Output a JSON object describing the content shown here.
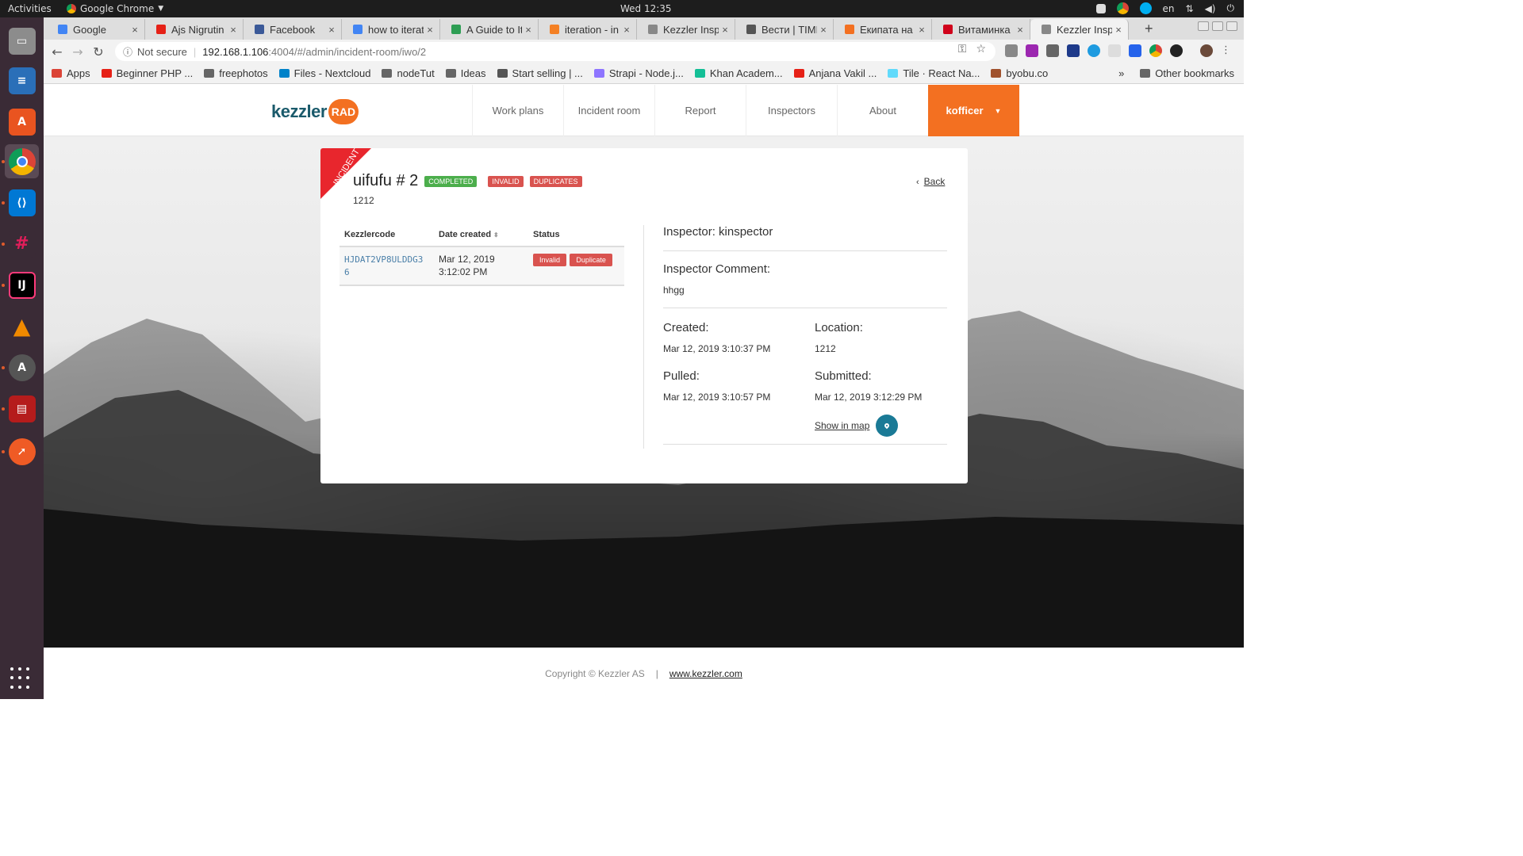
{
  "system": {
    "activities": "Activities",
    "app_name": "Google Chrome",
    "clock": "Wed 12:35",
    "lang": "en"
  },
  "tabs": [
    {
      "title": "Google",
      "color": "#4285f4"
    },
    {
      "title": "Ajs Nigrutin",
      "color": "#e62117"
    },
    {
      "title": "Facebook",
      "color": "#3b5998"
    },
    {
      "title": "how to iterat",
      "color": "#4285f4"
    },
    {
      "title": "A Guide to Ite",
      "color": "#2e9e54"
    },
    {
      "title": "iteration - in",
      "color": "#f48024"
    },
    {
      "title": "Kezzler Inspe",
      "color": "#888888"
    },
    {
      "title": "Вести | TIME",
      "color": "#555555"
    },
    {
      "title": "Екипата на",
      "color": "#f37021"
    },
    {
      "title": "Витаминка",
      "color": "#d0021b"
    },
    {
      "title": "Kezzler Inspe",
      "color": "#888888"
    }
  ],
  "omnibox": {
    "security": "Not secure",
    "host": "192.168.1.106",
    "path": ":4004/#/admin/incident-room/iwo/2"
  },
  "bookmarks": [
    {
      "label": "Apps",
      "color": "#db4437"
    },
    {
      "label": "Beginner PHP ...",
      "color": "#e62117"
    },
    {
      "label": "freephotos",
      "color": "#666666"
    },
    {
      "label": "Files - Nextcloud",
      "color": "#0082c9"
    },
    {
      "label": "nodeTut",
      "color": "#666666"
    },
    {
      "label": "Ideas",
      "color": "#666666"
    },
    {
      "label": "Start selling | ...",
      "color": "#555555"
    },
    {
      "label": "Strapi - Node.j...",
      "color": "#8e75ff"
    },
    {
      "label": "Khan Academ...",
      "color": "#14bf96"
    },
    {
      "label": "Anjana Vakil ...",
      "color": "#e62117"
    },
    {
      "label": "Tile · React Na...",
      "color": "#61dafb"
    },
    {
      "label": "byobu.co",
      "color": "#a0522d"
    }
  ],
  "bookmarks_more": "»",
  "other_bookmarks": "Other bookmarks",
  "site": {
    "logo_word": "kezzler",
    "logo_badge": "RAD",
    "nav": [
      "Work plans",
      "Incident room",
      "Report",
      "Inspectors",
      "About"
    ],
    "user": "kofficer"
  },
  "incident": {
    "ribbon": "INCIDENT",
    "title": "uifufu # 2",
    "badges": {
      "completed": "COMPLETED",
      "invalid": "INVALID",
      "duplicates": "DUPLICATES"
    },
    "subtitle": "1212",
    "back": "Back",
    "table": {
      "headers": [
        "Kezzlercode",
        "Date created",
        "Status"
      ],
      "rows": [
        {
          "code": "HJDAT2VP8ULDDG36",
          "date": "Mar 12, 2019",
          "time": "3:12:02 PM",
          "status": [
            "Invalid",
            "Duplicate"
          ]
        }
      ]
    },
    "inspector": "Inspector: kinspector",
    "comment_label": "Inspector Comment:",
    "comment": "hhgg",
    "created_label": "Created:",
    "created": "Mar 12, 2019 3:10:37 PM",
    "location_label": "Location:",
    "location": "1212",
    "pulled_label": "Pulled:",
    "pulled": "Mar 12, 2019 3:10:57 PM",
    "submitted_label": "Submitted:",
    "submitted": "Mar 12, 2019 3:12:29 PM",
    "show_in_map": "Show in map"
  },
  "footer": {
    "copyright": "Copyright © Kezzler AS",
    "separator": "|",
    "link": "www.kezzler.com"
  },
  "colors": {
    "accent": "#f37021",
    "brand": "#1a5a6b",
    "danger": "#d9534f",
    "success": "#4cae4c"
  }
}
